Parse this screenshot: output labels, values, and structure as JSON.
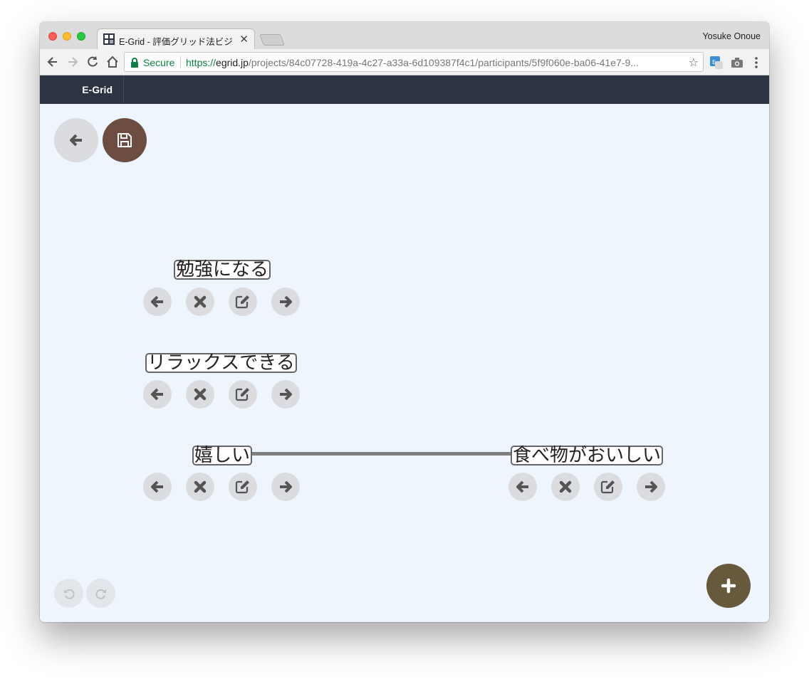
{
  "browser": {
    "tab_title": "E-Grid - 評価グリッド法ビジュ",
    "profile_name": "Yosuke Onoue",
    "secure_label": "Secure",
    "url_scheme": "https://",
    "url_host": "egrid.jp",
    "url_path": "/projects/84c07728-419a-4c27-a33a-6d109387f4c1/participants/5f9f060e-ba06-41e7-9..."
  },
  "app": {
    "brand": "E-Grid"
  },
  "nodes": [
    {
      "label": "勉強になる"
    },
    {
      "label": "リラックスできる"
    },
    {
      "label": "嬉しい"
    },
    {
      "label": "食べ物がおいしい"
    }
  ],
  "colors": {
    "navbar": "#2d3441",
    "save_fab": "#6d4c41",
    "add_fab": "#66593c",
    "canvas_bg": "#eff5fc",
    "button_gray": "#dadcdf",
    "link": "#808080"
  },
  "icons": {
    "back": "arrow-left-icon",
    "save": "floppy-disk-icon",
    "add": "plus-icon",
    "undo": "undo-icon",
    "redo": "redo-icon",
    "node_left": "arrow-left-icon",
    "node_remove": "times-icon",
    "node_edit": "edit-icon",
    "node_right": "arrow-right-icon"
  }
}
